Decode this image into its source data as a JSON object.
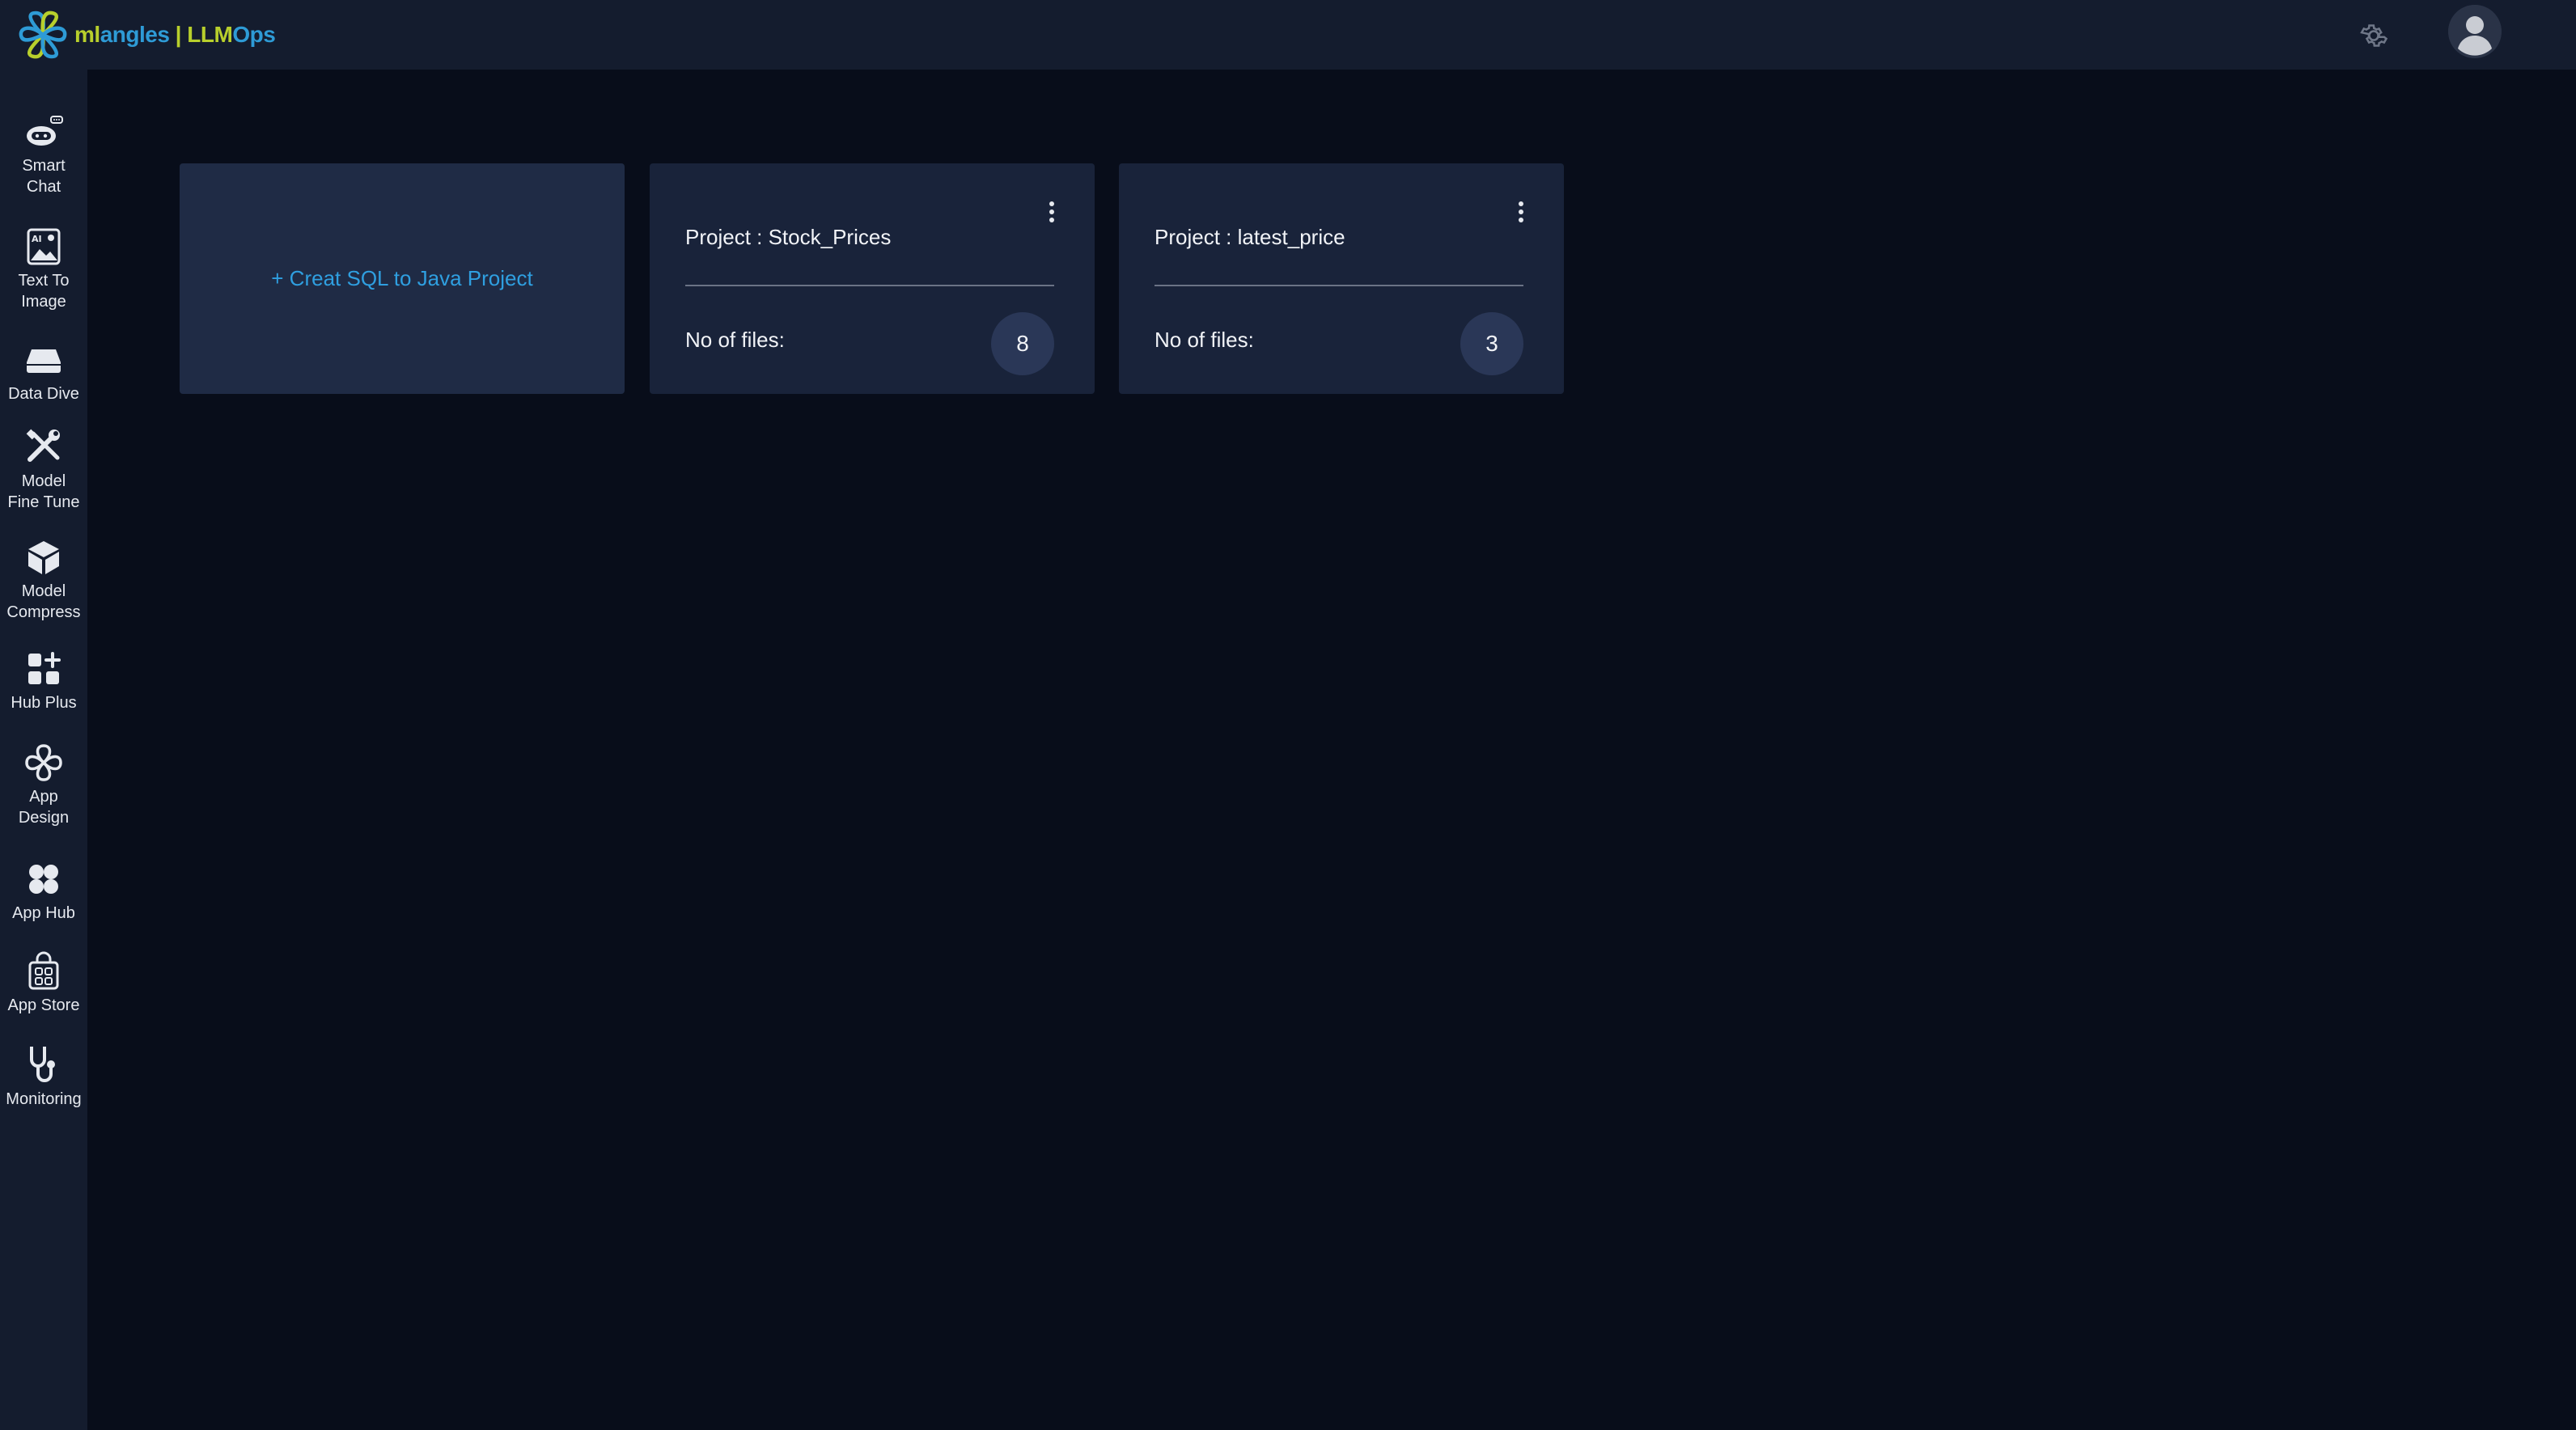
{
  "app": {
    "logo_ml": "ml",
    "logo_angles": "angles",
    "logo_sep": " | ",
    "logo_llm": "LLM",
    "logo_ops": "Ops",
    "brand_green": "#b8cf2c",
    "brand_blue": "#2e9bd6"
  },
  "header": {
    "settings_icon": "gear-icon",
    "avatar_icon": "user-avatar-icon"
  },
  "sidebar": {
    "items": [
      {
        "label": "Smart\nChat",
        "icon": "robot-chat-icon"
      },
      {
        "label": "Text To\nImage",
        "icon": "ai-image-icon"
      },
      {
        "label": "Data Dive",
        "icon": "database-drive-icon"
      },
      {
        "label": "Model\nFine Tune",
        "icon": "tools-icon"
      },
      {
        "label": "Model\nCompress",
        "icon": "cube-icon"
      },
      {
        "label": "Hub Plus",
        "icon": "grid-plus-icon"
      },
      {
        "label": "App\nDesign",
        "icon": "app-design-icon"
      },
      {
        "label": "App Hub",
        "icon": "app-hub-icon"
      },
      {
        "label": "App Store",
        "icon": "shopping-bag-icon"
      },
      {
        "label": "Monitoring",
        "icon": "stethoscope-icon"
      }
    ]
  },
  "main": {
    "create_card": {
      "label": "+ Creat SQL to Java Project",
      "color": "#2f9fe0"
    },
    "projects": [
      {
        "title": "Project : Stock_Prices",
        "files_label": "No of files:",
        "files_count": "8"
      },
      {
        "title": "Project : latest_price",
        "files_label": "No of files:",
        "files_count": "3"
      }
    ]
  }
}
